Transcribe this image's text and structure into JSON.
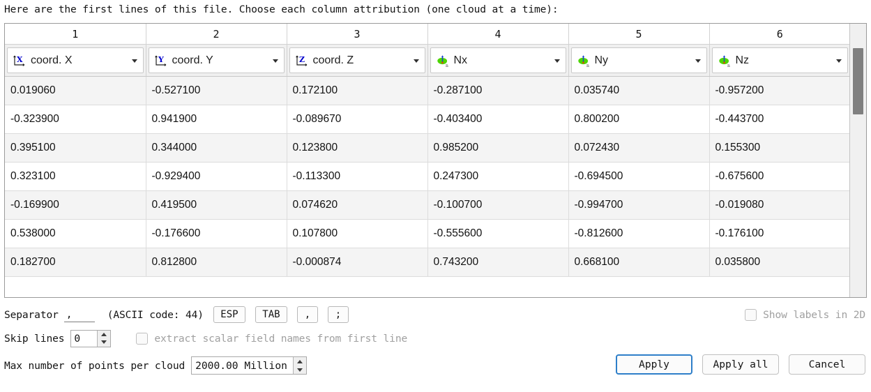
{
  "dialog": {
    "intro": "Here are the first lines of this file. Choose each column attribution (one cloud at a time):"
  },
  "table": {
    "column_numbers": [
      "1",
      "2",
      "3",
      "4",
      "5",
      "6"
    ],
    "column_assignments": [
      {
        "label": "coord. X",
        "icon": "axis-x-icon"
      },
      {
        "label": "coord. Y",
        "icon": "axis-y-icon"
      },
      {
        "label": "coord. Z",
        "icon": "axis-z-icon"
      },
      {
        "label": "Nx",
        "icon": "normal-vector-icon"
      },
      {
        "label": "Ny",
        "icon": "normal-vector-icon"
      },
      {
        "label": "Nz",
        "icon": "normal-vector-icon"
      }
    ],
    "rows": [
      [
        "0.019060",
        "-0.527100",
        "0.172100",
        "-0.287100",
        "0.035740",
        "-0.957200"
      ],
      [
        "-0.323900",
        "0.941900",
        "-0.089670",
        "-0.403400",
        "0.800200",
        "-0.443700"
      ],
      [
        "0.395100",
        "0.344000",
        "0.123800",
        "0.985200",
        "0.072430",
        "0.155300"
      ],
      [
        "0.323100",
        "-0.929400",
        "-0.113300",
        "0.247300",
        "-0.694500",
        "-0.675600"
      ],
      [
        "-0.169900",
        "0.419500",
        "0.074620",
        "-0.100700",
        "-0.994700",
        "-0.019080"
      ],
      [
        "0.538000",
        "-0.176600",
        "0.107800",
        "-0.555600",
        "-0.812600",
        "-0.176100"
      ],
      [
        "0.182700",
        "0.812800",
        "-0.000874",
        "0.743200",
        "0.668100",
        "0.035800"
      ]
    ]
  },
  "separator_row": {
    "label": "Separator",
    "value": ",",
    "ascii_text": "(ASCII code: 44)",
    "buttons": [
      "ESP",
      "TAB",
      ",",
      ";"
    ]
  },
  "show_labels": {
    "label": "Show labels in 2D",
    "checked": false
  },
  "skip_row": {
    "label": "Skip lines",
    "value": "0",
    "extract_label": "extract scalar field names from first line",
    "extract_checked": false
  },
  "max_points": {
    "label": "Max number of points per cloud",
    "value": "2000.00 Million"
  },
  "buttons": {
    "apply": "Apply",
    "apply_all": "Apply all",
    "cancel": "Cancel"
  },
  "colors": {
    "accent": "#2e7fc9",
    "axis_letter": "#0000cc",
    "normal_patch": "#4cd500",
    "normal_arrow": "#1a3fd0",
    "scrollbar_thumb": "#808080"
  }
}
